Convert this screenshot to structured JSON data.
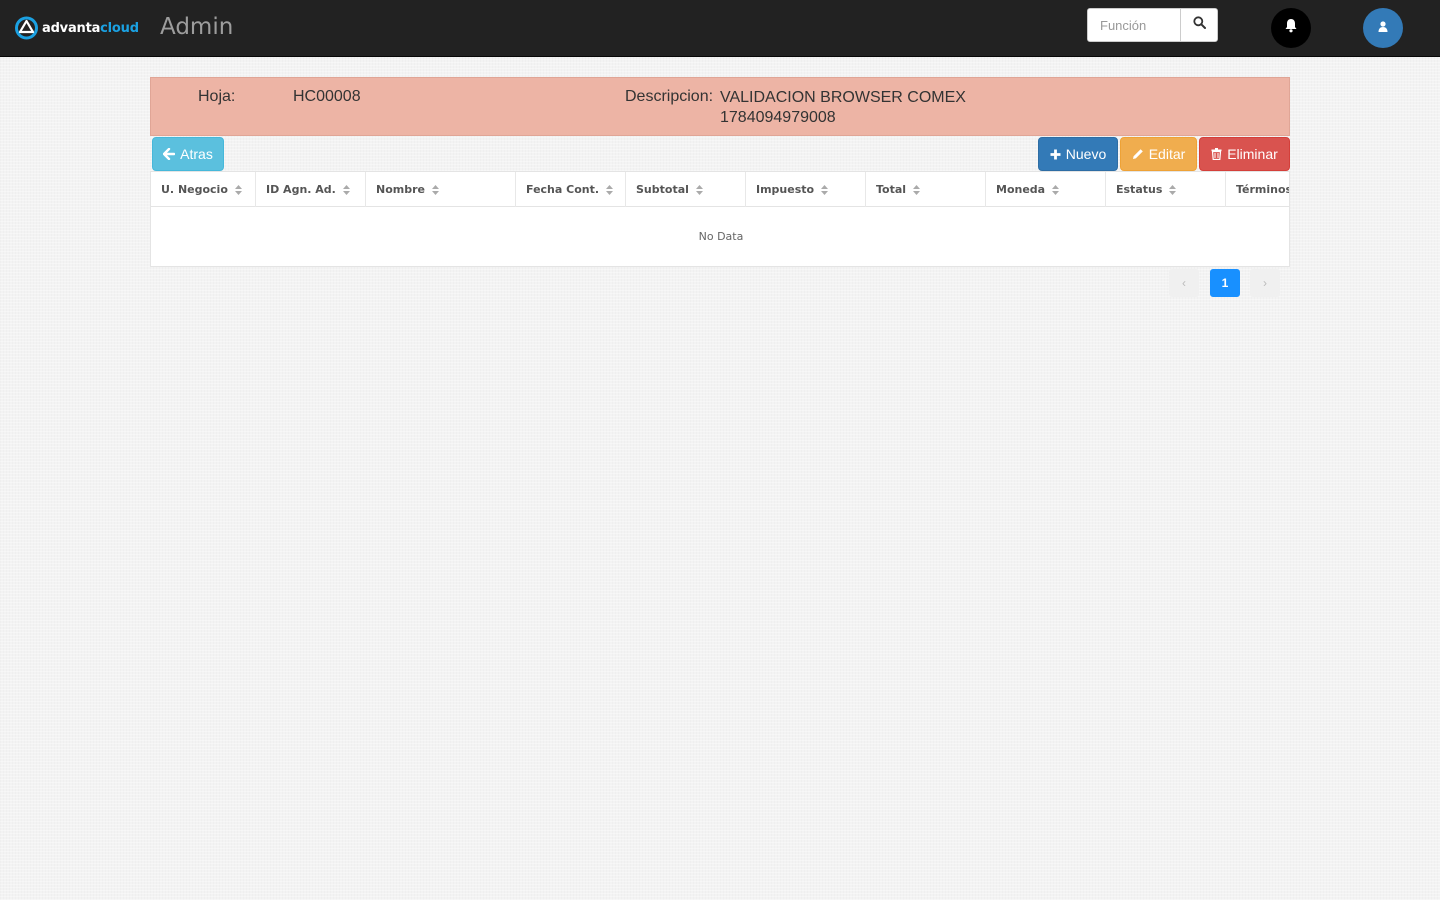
{
  "topbar": {
    "logo_text_a": "advanta",
    "logo_text_b": "cloud",
    "app_title": "Admin",
    "search_placeholder": "Función",
    "icons": [
      "search-icon",
      "bell-icon",
      "user-icon"
    ]
  },
  "header": {
    "hoja_label": "Hoja:",
    "hoja_value": "HC00008",
    "descripcion_label": "Descripcion:",
    "descripcion_value": "VALIDACION BROWSER COMEX 1784094979008"
  },
  "actions": {
    "back_label": "Atras",
    "new_label": "Nuevo",
    "edit_label": "Editar",
    "delete_label": "Eliminar"
  },
  "table": {
    "columns": [
      "U. Negocio",
      "ID Agn. Ad.",
      "Nombre",
      "Fecha Cont.",
      "Subtotal",
      "Impuesto",
      "Total",
      "Moneda",
      "Estatus",
      "Términos"
    ],
    "empty_text": "No Data"
  },
  "pagination": {
    "current_page": "1",
    "prev_label": "‹",
    "next_label": "›"
  },
  "colors": {
    "topbar_bg": "#222222",
    "header_band_bg": "#edb4a5",
    "info": "#5bc0de",
    "primary": "#337ab7",
    "warning": "#f0ad4e",
    "danger": "#d9534f",
    "pagination_active": "#1890ff"
  }
}
